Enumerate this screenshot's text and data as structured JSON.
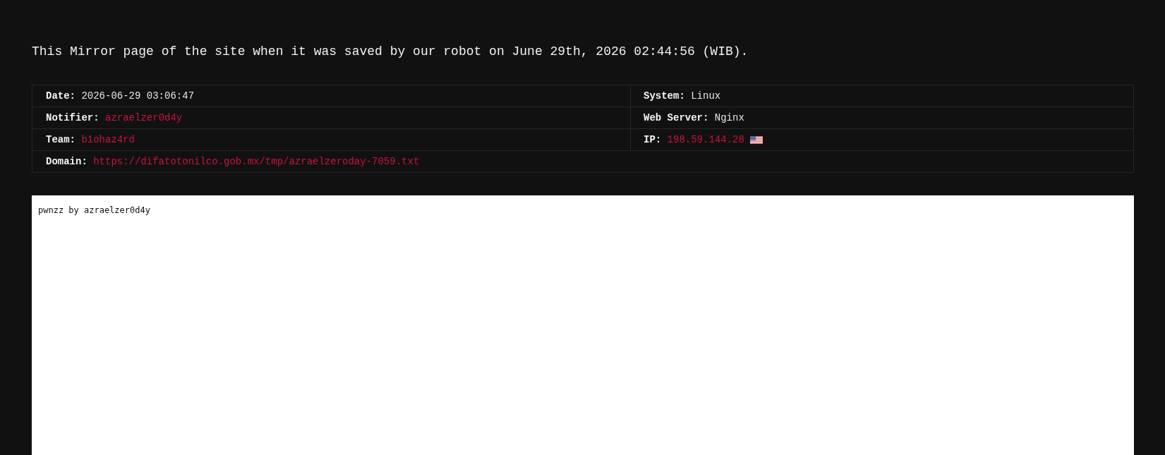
{
  "notice": {
    "text": "This Mirror page of the site when it was saved by our robot on June 29th, 2026 02:44:56 (WIB)."
  },
  "details": {
    "rows": [
      {
        "cells": [
          {
            "label": "Date:",
            "value": "2026-06-29 03:06:47",
            "kind": "text"
          },
          {
            "label": "System:",
            "value": "Linux",
            "kind": "text"
          }
        ]
      },
      {
        "cells": [
          {
            "label": "Notifier:",
            "value": "azraelzer0d4y",
            "kind": "link"
          },
          {
            "label": "Web Server:",
            "value": "Nginx",
            "kind": "text"
          }
        ]
      },
      {
        "cells": [
          {
            "label": "Team:",
            "value": "b1ohaz4rd",
            "kind": "link"
          },
          {
            "label": "IP:",
            "value": "198.59.144.28",
            "kind": "ip"
          }
        ]
      },
      {
        "cells": [
          {
            "label": "Domain:",
            "value": "https://difatotonilco.gob.mx/tmp/azraelzeroday-7059.txt",
            "kind": "link"
          }
        ]
      }
    ]
  },
  "mirror_frame": {
    "text": "pwnzz by azraelzer0d4y"
  }
}
